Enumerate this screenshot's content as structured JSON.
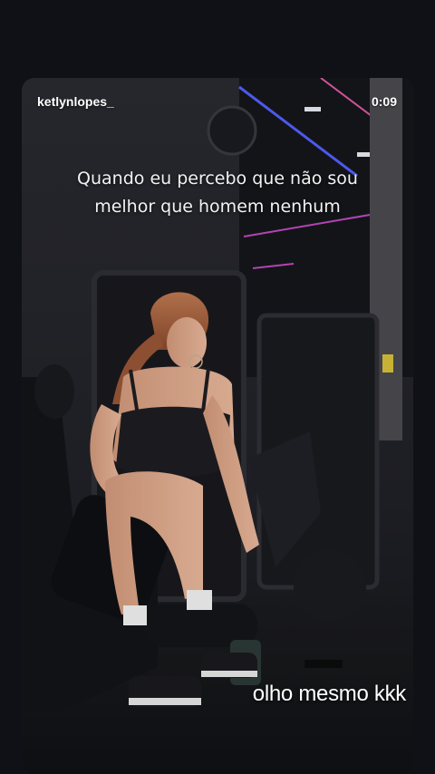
{
  "story": {
    "username": "ketlynlopes_",
    "time": "0:09",
    "caption_lines": [
      "Quando eu percebo que não sou",
      "melhor que homem nenhum"
    ],
    "overlay_text": "olho mesmo kkk"
  }
}
